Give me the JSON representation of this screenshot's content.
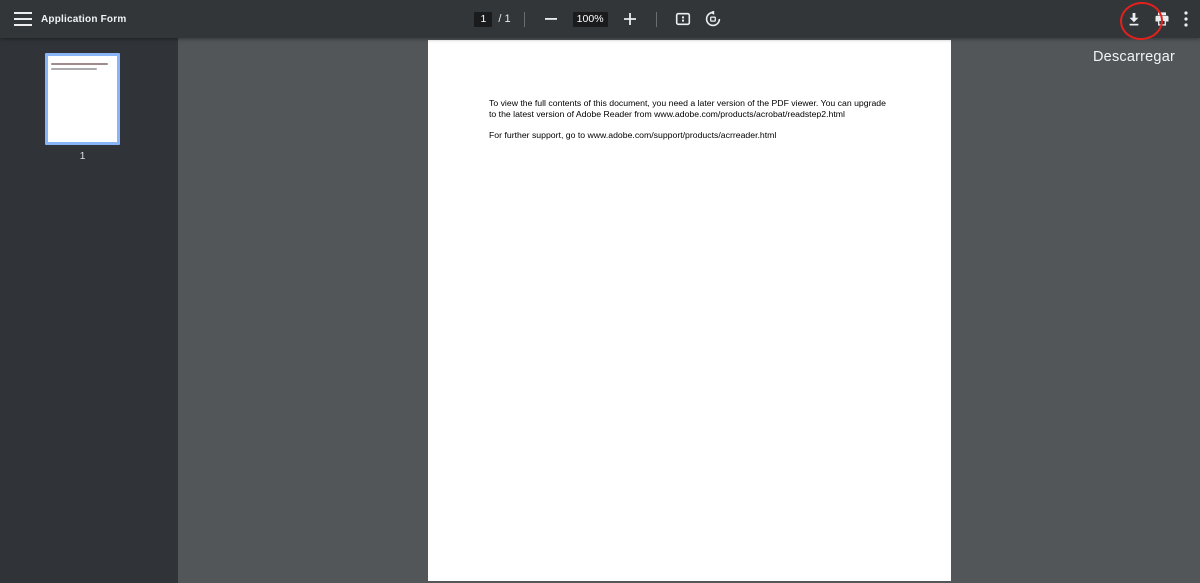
{
  "toolbar": {
    "title": "Application Form",
    "page_current": "1",
    "page_total_label": "/ 1",
    "zoom_level": "100%",
    "icons": {
      "menu": "hamburger-menu-icon",
      "zoom_out": "minus-icon",
      "zoom_in": "plus-icon",
      "fit_page": "fit-to-page-icon",
      "rotate": "rotate-counterclockwise-icon",
      "download": "download-icon",
      "print": "print-icon",
      "more": "three-dot-menu-icon"
    }
  },
  "sidebar": {
    "thumbnail": {
      "page_label": "1",
      "selected": true
    }
  },
  "document": {
    "para1_line1": "To view the full contents of this document, you need a later version of the PDF viewer. You can upgrade",
    "para1_line2": "to the latest version of Adobe Reader from www.adobe.com/products/acrobat/readstep2.html",
    "para2_line1": "For further support, go to www.adobe.com/support/products/acrreader.html"
  },
  "tooltip": {
    "download_label": "Descarregar"
  },
  "annotation": {
    "shape": "red-ellipse",
    "target": "download-button",
    "color": "#e3211c"
  },
  "colors": {
    "toolbar_bg": "#323639",
    "sidebar_bg": "#303438",
    "viewer_bg": "#525659",
    "control_box_bg": "#191b1c",
    "thumbnail_selected_border": "#8ab4f8",
    "icon_color": "#eceef0"
  }
}
